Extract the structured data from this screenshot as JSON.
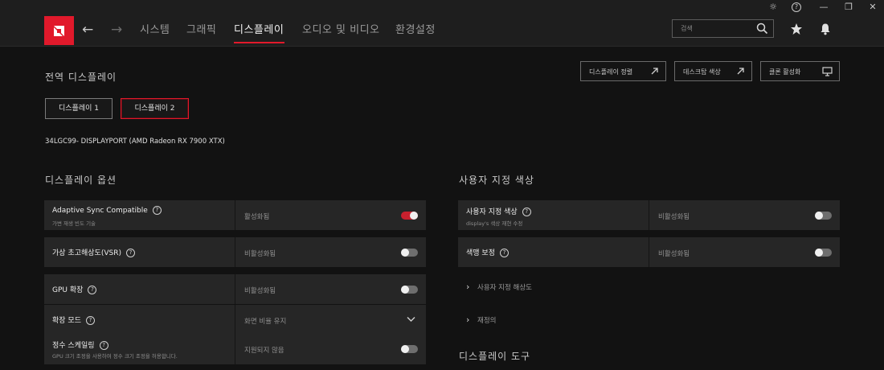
{
  "window": {
    "controls": [
      {
        "icon": "bug-icon",
        "glyph": "☼"
      },
      {
        "icon": "help-icon",
        "glyph": "?"
      },
      {
        "icon": "minimize-icon",
        "glyph": "—"
      },
      {
        "icon": "restore-icon",
        "glyph": "❐"
      },
      {
        "icon": "close-icon",
        "glyph": "✕"
      }
    ]
  },
  "nav": {
    "back_icon": "←",
    "forward_icon": "→",
    "tabs": [
      {
        "label": "시스템"
      },
      {
        "label": "그래픽"
      },
      {
        "label": "디스플레이"
      },
      {
        "label": "오디오 및 비디오"
      },
      {
        "label": "환경설정"
      }
    ],
    "active_tab": "디스플레이",
    "search_placeholder": "검색"
  },
  "colors": {
    "accent": "#e1192b",
    "background": "#121212",
    "row": "#262626"
  },
  "page": {
    "title": "전역 디스플레이",
    "header_buttons": [
      {
        "label": "디스플레이 정렬",
        "icon": "external-link-icon"
      },
      {
        "label": "데스크탑 색상",
        "icon": "external-link-icon"
      },
      {
        "label": "클론 활성화",
        "icon": "monitor-icon"
      }
    ],
    "displays": [
      {
        "label": "디스플레이 1",
        "selected": false
      },
      {
        "label": "디스플레이 2",
        "selected": true
      }
    ],
    "monitor_name": "34LGC99- DISPLAYPORT (AMD Radeon RX 7900 XTX)"
  },
  "display_options": {
    "title": "디스플레이 옵션",
    "rows": [
      {
        "label": "Adaptive Sync Compatible",
        "sub": "가변 재생 빈도 기술",
        "value": "활성화됨",
        "control": "toggle",
        "on": true
      },
      {
        "label": "가상 초고해상도(VSR)",
        "sub": "",
        "value": "비활성화됨",
        "control": "toggle",
        "on": false
      },
      {
        "label": "GPU 확장",
        "sub": "",
        "value": "비활성화됨",
        "control": "toggle",
        "on": false
      },
      {
        "label": "확장 모드",
        "sub": "",
        "value": "화면 비율 유지",
        "control": "dropdown",
        "on": false
      },
      {
        "label": "정수 스케일링",
        "sub": "GPU 크기 조정을 사용하여 정수 크기 조정을 허용합니다.",
        "value": "지원되지 않음",
        "control": "toggle",
        "on": false
      }
    ]
  },
  "custom_color": {
    "title": "사용자 지정 색상",
    "rows": [
      {
        "label": "사용자 지정 색상",
        "sub": "display's 색상 재현 수정",
        "value": "비활성화됨",
        "on": false
      },
      {
        "label": "색맹 보정",
        "sub": "",
        "value": "비활성화됨",
        "on": false
      }
    ],
    "links": [
      {
        "label": "사용자 지정 해상도"
      },
      {
        "label": "재정의"
      }
    ]
  },
  "display_tools": {
    "title": "디스플레이 도구"
  }
}
